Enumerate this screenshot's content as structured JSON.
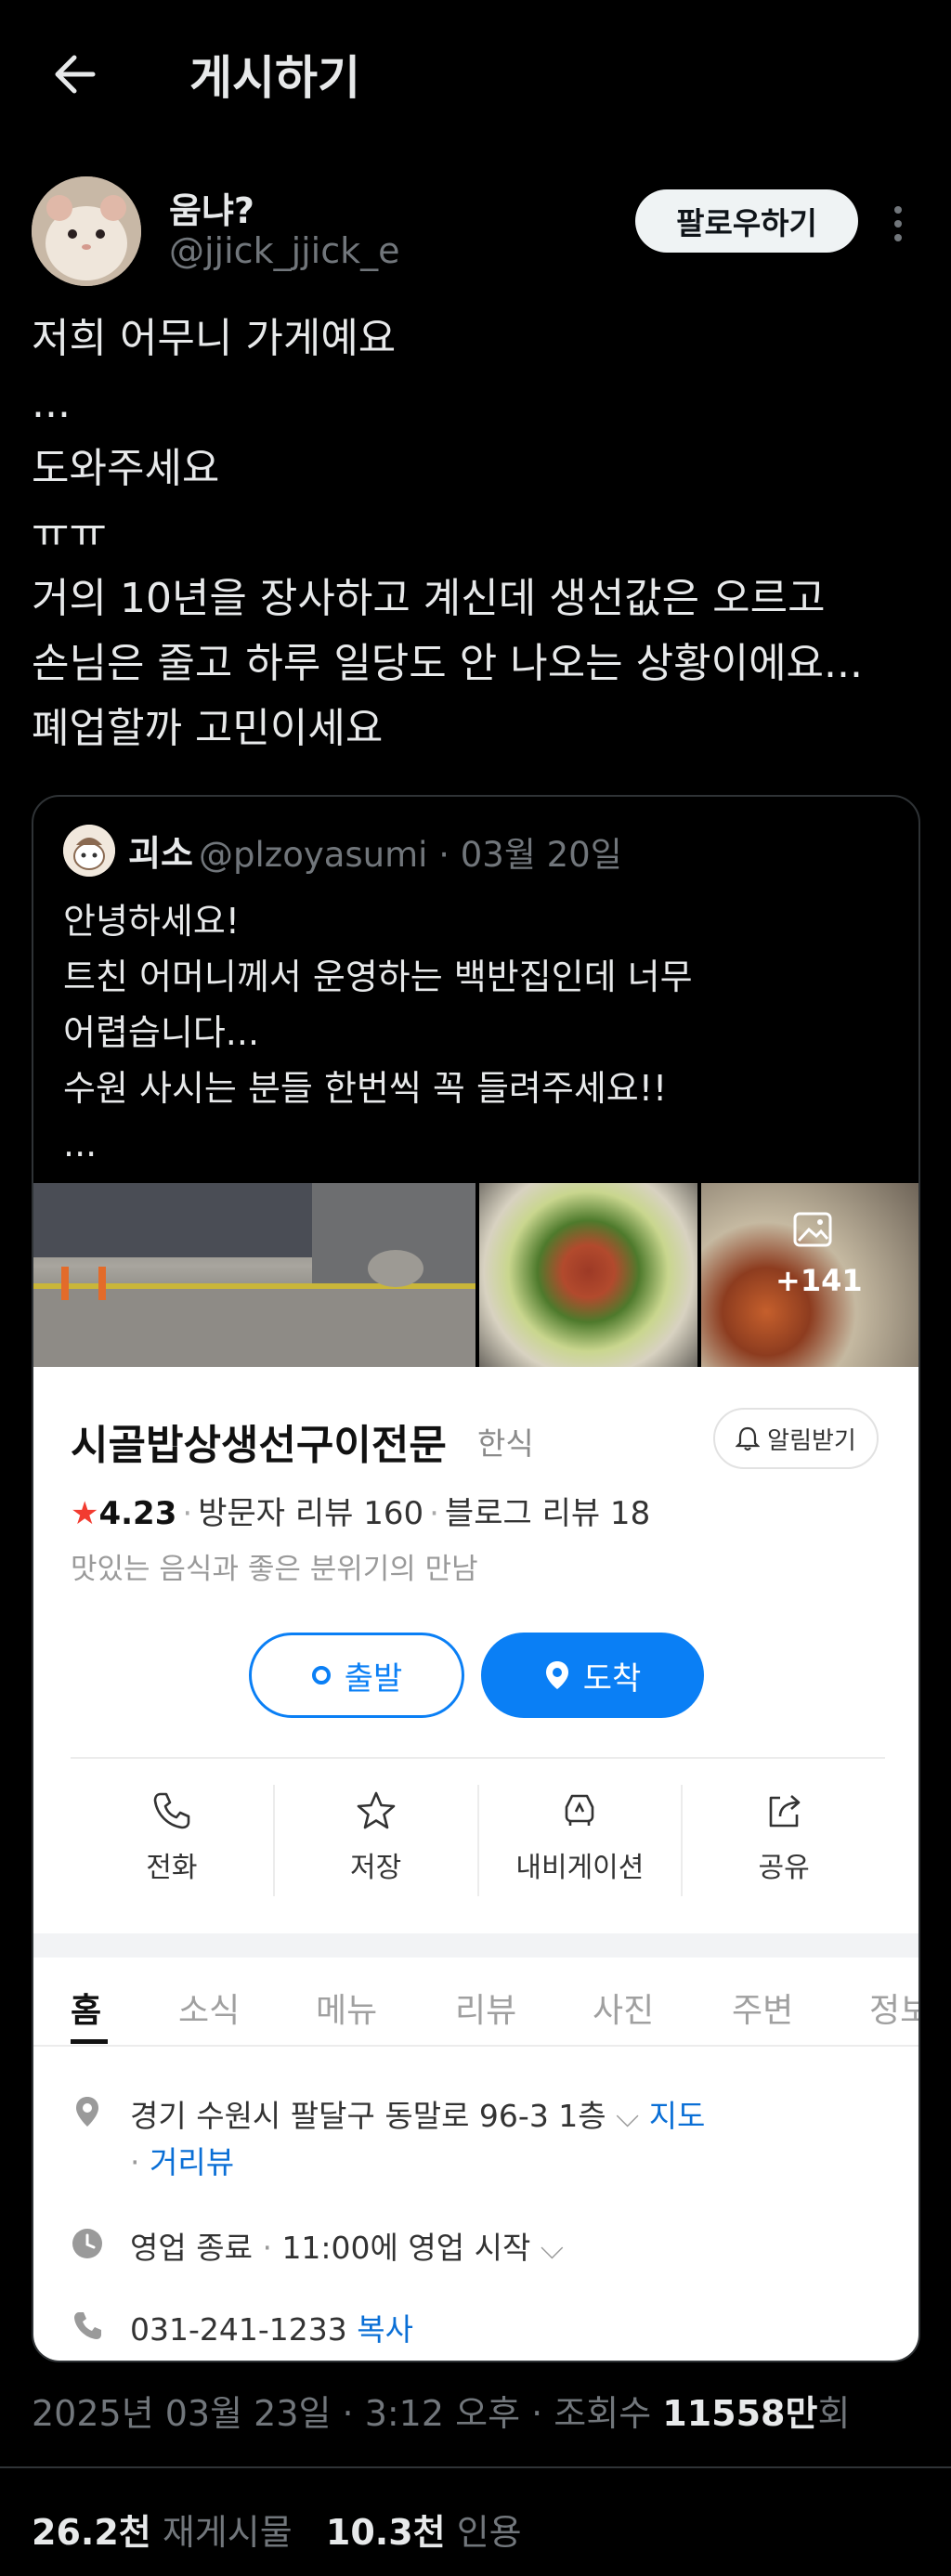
{
  "header": {
    "title": "게시하기"
  },
  "author": {
    "name": "움냐?",
    "handle": "@jjick_jjick_e",
    "follow_label": "팔로우하기"
  },
  "post": {
    "lines": [
      "저희 어무니 가게예요",
      "...",
      "도와주세요",
      "ㅠㅠ",
      "거의 10년을 장사하고 계신데 생선값은 오르고",
      "손님은 줄고 하루 일당도 안 나오는 상황이에요...",
      "폐업할까 고민이세요"
    ]
  },
  "quoted": {
    "name": "괴소",
    "handle": "@plzoyasumi",
    "date": "03월 20일",
    "lines": [
      "안녕하세요!",
      "트친 어머니께서 운영하는 백반집인데 너무",
      "어렵습니다...",
      "수원 사시는 분들 한번씩 꼭 들려주세요!!",
      "..."
    ],
    "photo_more": "+141"
  },
  "place": {
    "name": "시골밥상생선구이전문",
    "category": "한식",
    "alarm_label": "알림받기",
    "rating": "4.23",
    "visitor_reviews": "방문자 리뷰 160",
    "blog_reviews": "블로그 리뷰 18",
    "slogan": "맛있는 음식과 좋은 분위기의 만남",
    "start_label": "출발",
    "dest_label": "도착",
    "actions": [
      {
        "label": "전화",
        "icon": "phone-icon"
      },
      {
        "label": "저장",
        "icon": "star-icon"
      },
      {
        "label": "내비게이션",
        "icon": "car-icon"
      },
      {
        "label": "공유",
        "icon": "share-icon"
      }
    ],
    "tabs": [
      "홈",
      "소식",
      "메뉴",
      "리뷰",
      "사진",
      "주변",
      "정보"
    ],
    "address": "경기 수원시 팔달구 동말로 96-3 1층",
    "map_link": "지도",
    "street_view": "거리뷰",
    "status": "영업 종료",
    "hours": "11:00에 영업 시작",
    "phone": "031-241-1233",
    "copy_label": "복사"
  },
  "meta": {
    "date": "2025년 03월 23일",
    "time": "3:12 오후",
    "views_label": "조회수",
    "views": "11558만",
    "views_suffix": "회"
  },
  "stats": {
    "reposts": "26.2천",
    "reposts_label": "재게시물",
    "quotes": "10.3천",
    "quotes_label": "인용"
  }
}
